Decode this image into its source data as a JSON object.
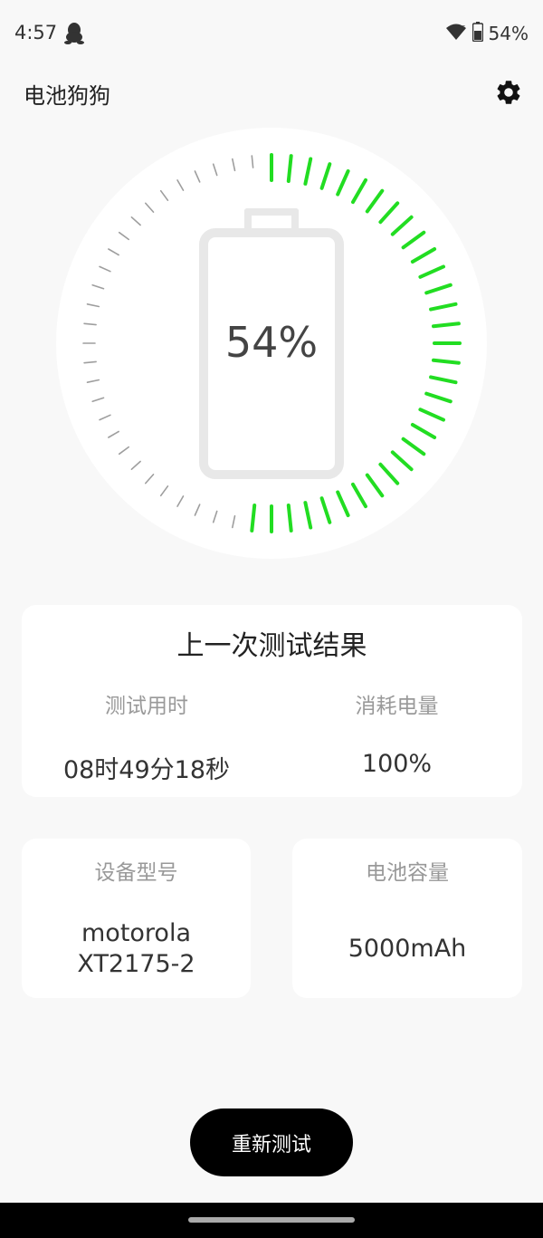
{
  "status_bar": {
    "time": "4:57",
    "battery_text": "54%",
    "icons": [
      "qq-icon",
      "wifi-icon",
      "battery-icon"
    ]
  },
  "app_bar": {
    "title": "电池狗狗",
    "settings_icon": "gear-icon"
  },
  "gauge": {
    "percent_text": "54%",
    "level": 0.54,
    "active_color": "#22dd22",
    "inactive_color": "#9e9e9e"
  },
  "last_result": {
    "title": "上一次测试结果",
    "duration_label": "测试用时",
    "duration_value": "08时49分18秒",
    "consumed_label": "消耗电量",
    "consumed_value": "100%"
  },
  "device": {
    "label": "设备型号",
    "value_line1": "motorola",
    "value_line2": "XT2175-2"
  },
  "capacity": {
    "label": "电池容量",
    "value": "5000mAh"
  },
  "actions": {
    "retest_label": "重新测试"
  }
}
